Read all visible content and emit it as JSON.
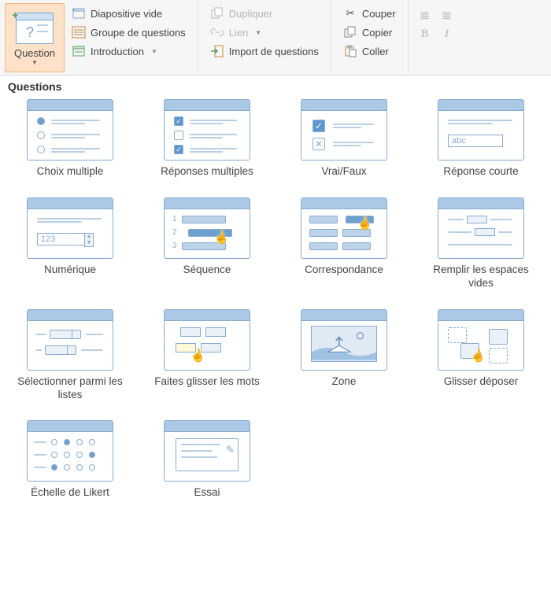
{
  "ribbon": {
    "question_btn": "Question",
    "col1": {
      "slide": "Diapositive vide",
      "group": "Groupe de questions",
      "intro": "Introduction"
    },
    "col2": {
      "dup": "Dupliquer",
      "link": "Lien",
      "import": "Import de questions"
    },
    "col3": {
      "cut": "Couper",
      "copy": "Copier",
      "paste": "Coller"
    }
  },
  "panel_title": "Questions",
  "types": {
    "t0": "Choix multiple",
    "t1": "Réponses multiples",
    "t2": "Vrai/Faux",
    "t3": "Réponse courte",
    "t4": "Numérique",
    "t5": "Séquence",
    "t6": "Correspondance",
    "t7": "Remplir les espaces vides",
    "t8": "Sélectionner parmi les listes",
    "t9": "Faites glisser les mots",
    "t10": "Zone",
    "t11": "Glisser déposer",
    "t12": "Échelle de Likert",
    "t13": "Essai"
  },
  "placeholders": {
    "abc": "abc",
    "n123": "123"
  }
}
